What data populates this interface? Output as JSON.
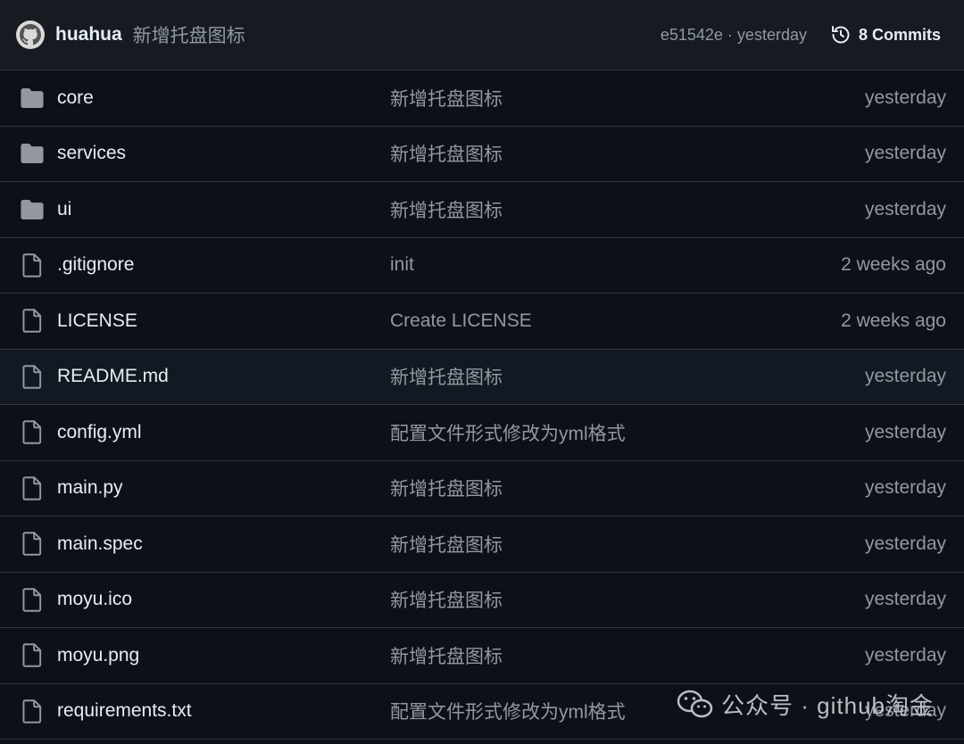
{
  "header": {
    "author": "huahua",
    "commit_message": "新增托盘图标",
    "commit_meta": "e51542e · yesterday",
    "commits_label": "8 Commits"
  },
  "files": [
    {
      "name": "core",
      "type": "folder",
      "message": "新增托盘图标",
      "date": "yesterday"
    },
    {
      "name": "services",
      "type": "folder",
      "message": "新增托盘图标",
      "date": "yesterday"
    },
    {
      "name": "ui",
      "type": "folder",
      "message": "新增托盘图标",
      "date": "yesterday"
    },
    {
      "name": ".gitignore",
      "type": "file",
      "message": "init",
      "date": "2 weeks ago"
    },
    {
      "name": "LICENSE",
      "type": "file",
      "message": "Create LICENSE",
      "date": "2 weeks ago"
    },
    {
      "name": "README.md",
      "type": "file",
      "message": "新增托盘图标",
      "date": "yesterday"
    },
    {
      "name": "config.yml",
      "type": "file",
      "message": "配置文件形式修改为yml格式",
      "date": "yesterday"
    },
    {
      "name": "main.py",
      "type": "file",
      "message": "新增托盘图标",
      "date": "yesterday"
    },
    {
      "name": "main.spec",
      "type": "file",
      "message": "新增托盘图标",
      "date": "yesterday"
    },
    {
      "name": "moyu.ico",
      "type": "file",
      "message": "新增托盘图标",
      "date": "yesterday"
    },
    {
      "name": "moyu.png",
      "type": "file",
      "message": "新增托盘图标",
      "date": "yesterday"
    },
    {
      "name": "requirements.txt",
      "type": "file",
      "message": "配置文件形式修改为yml格式",
      "date": "yesterday"
    }
  ],
  "watermark": "公众号 · github淘金",
  "colors": {
    "background": "#0d1117",
    "header_bg": "#161b22",
    "border": "#30363d",
    "text_primary": "#e6edf3",
    "text_muted": "#9198a1",
    "folder_icon": "#9198a1"
  }
}
